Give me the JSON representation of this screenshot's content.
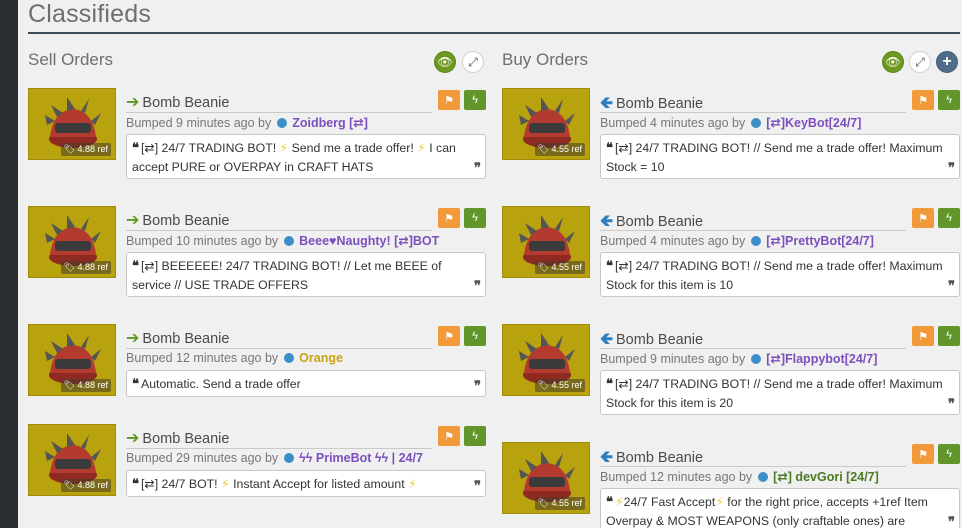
{
  "page": {
    "title": "Classifieds"
  },
  "sell": {
    "title": "Sell Orders",
    "listings": [
      {
        "item": "Bomb Beanie",
        "price": "4.88 ref",
        "bumped": "Bumped 9 minutes ago by",
        "user": "Zoidberg [⇄]",
        "user_color": "#7d4fbd",
        "message": [
          "[⇄] 24/7 TRADING BOT! ",
          "⚡",
          " Send me a trade offer! ",
          "⚡",
          " I can accept PURE or OVERPAY in CRAFT HATS"
        ]
      },
      {
        "item": "Bomb Beanie",
        "price": "4.88 ref",
        "bumped": "Bumped 10 minutes ago by",
        "user": "Beee♥Naughty! [⇄]BOT",
        "user_color": "#7d4fbd",
        "message": [
          "[⇄] BEEEEEE! 24/7 TRADING BOT! // Let me BEEE of service // USE TRADE OFFERS"
        ]
      },
      {
        "item": "Bomb Beanie",
        "price": "4.88 ref",
        "bumped": "Bumped 12 minutes ago by",
        "user": "Orange",
        "user_color": "#c9a319",
        "message": [
          "Automatic. Send a trade offer"
        ]
      },
      {
        "item": "Bomb Beanie",
        "price": "4.88 ref",
        "bumped": "Bumped 29 minutes ago by",
        "user": "ϟϟ PrimeBot ϟϟ | 24/7",
        "user_color": "#7d4fbd",
        "message": [
          "[⇄] 24/7 BOT! ",
          "⚡",
          " Instant Accept for listed amount ",
          "⚡"
        ]
      }
    ]
  },
  "buy": {
    "title": "Buy Orders",
    "listings": [
      {
        "item": "Bomb Beanie",
        "price": "4.55 ref",
        "bumped": "Bumped 4 minutes ago by",
        "user": "[⇄]KeyBot[24/7]",
        "user_color": "#7d4fbd",
        "message": [
          "[⇄] 24/7 TRADING BOT! // Send me a trade offer! Maximum Stock = 10"
        ]
      },
      {
        "item": "Bomb Beanie",
        "price": "4.55 ref",
        "bumped": "Bumped 4 minutes ago by",
        "user": "[⇄]PrettyBot[24/7]",
        "user_color": "#7d4fbd",
        "message": [
          "[⇄] 24/7 TRADING BOT! // Send me a trade offer! Maximum Stock for this item is 10"
        ]
      },
      {
        "item": "Bomb Beanie",
        "price": "4.55 ref",
        "bumped": "Bumped 9 minutes ago by",
        "user": "[⇄]Flappybot[24/7]",
        "user_color": "#7d4fbd",
        "message": [
          "[⇄] 24/7 TRADING BOT! // Send me a trade offer! Maximum Stock for this item is 20"
        ]
      },
      {
        "item": "Bomb Beanie",
        "price": "4.55 ref",
        "bumped": "Bumped 12 minutes ago by",
        "user": "[⇄] devGori [24/7]",
        "user_color": "#4a7a23",
        "message": [
          "⚡",
          "24/7 Fast Accept",
          "⚡",
          " for the right price, accepts +1ref Item Overpay & MOST WEAPONS (only craftable ones) are"
        ]
      }
    ]
  },
  "colors": {
    "accent_sell": "#5b9a1e",
    "accent_buy": "#2f7fbf",
    "thumb_bg": "#b8a20d"
  },
  "icons": [
    "eye-icon",
    "expand-icon",
    "plus-icon",
    "flag-icon",
    "lightning-icon",
    "tag-icon",
    "quote-icon"
  ]
}
